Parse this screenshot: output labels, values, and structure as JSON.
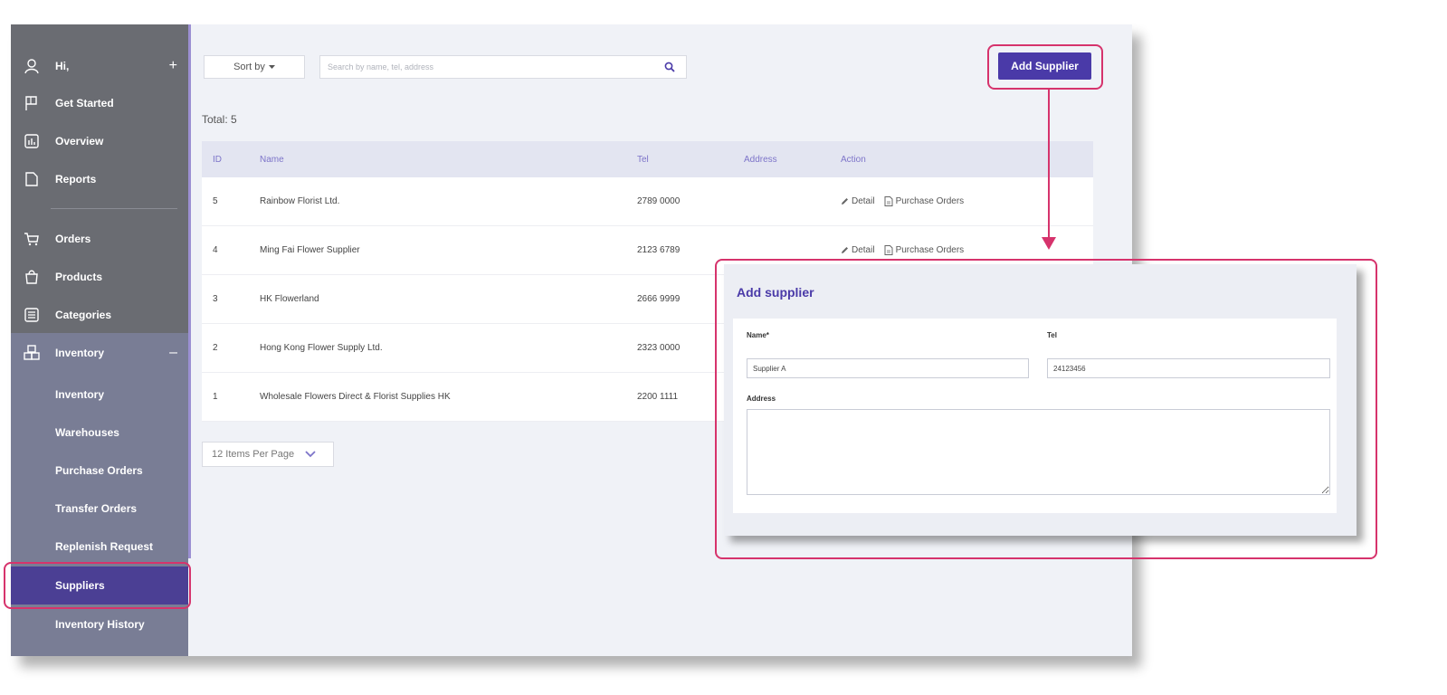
{
  "sidebar": {
    "items": [
      {
        "label": "Hi,",
        "icon": "user-icon",
        "trail": "+"
      },
      {
        "label": "Get Started",
        "icon": "flag-icon"
      },
      {
        "label": "Overview",
        "icon": "chart-icon"
      },
      {
        "label": "Reports",
        "icon": "document-icon"
      },
      {
        "label": "Orders",
        "icon": "cart-icon"
      },
      {
        "label": "Products",
        "icon": "bag-icon"
      },
      {
        "label": "Categories",
        "icon": "list-icon"
      },
      {
        "label": "Inventory",
        "icon": "boxes-icon",
        "trail": "–"
      }
    ],
    "sub_items": [
      {
        "label": "Inventory"
      },
      {
        "label": "Warehouses"
      },
      {
        "label": "Purchase Orders"
      },
      {
        "label": "Transfer Orders"
      },
      {
        "label": "Replenish Request"
      },
      {
        "label": "Suppliers",
        "active": true
      },
      {
        "label": "Inventory History"
      }
    ]
  },
  "toolbar": {
    "sort_label": "Sort by",
    "search_placeholder": "Search by name, tel, address",
    "add_button": "Add Supplier"
  },
  "total_label": "Total: 5",
  "table": {
    "columns": [
      "ID",
      "Name",
      "Tel",
      "Address",
      "Action"
    ],
    "rows": [
      {
        "id": "5",
        "name": "Rainbow Florist Ltd.",
        "tel": "2789 0000",
        "address": ""
      },
      {
        "id": "4",
        "name": "Ming Fai Flower Supplier",
        "tel": "2123 6789",
        "address": ""
      },
      {
        "id": "3",
        "name": "HK Flowerland",
        "tel": "2666 9999",
        "address": ""
      },
      {
        "id": "2",
        "name": "Hong Kong Flower Supply Ltd.",
        "tel": "2323 0000",
        "address": ""
      },
      {
        "id": "1",
        "name": "Wholesale Flowers Direct & Florist Supplies HK",
        "tel": "2200 1111",
        "address": ""
      }
    ],
    "action_detail": "Detail",
    "action_po": "Purchase Orders"
  },
  "pagination": {
    "per_page": "12 Items Per Page"
  },
  "modal": {
    "title": "Add supplier",
    "name_label": "Name*",
    "name_value": "Supplier A",
    "tel_label": "Tel",
    "tel_value": "24123456",
    "address_label": "Address",
    "address_value": ""
  },
  "colors": {
    "accent": "#4a3aa8",
    "highlight": "#d6336c",
    "sidebar": "#6a6c72",
    "sidebar_sub": "#797d95",
    "active_item": "#4b3f94"
  }
}
